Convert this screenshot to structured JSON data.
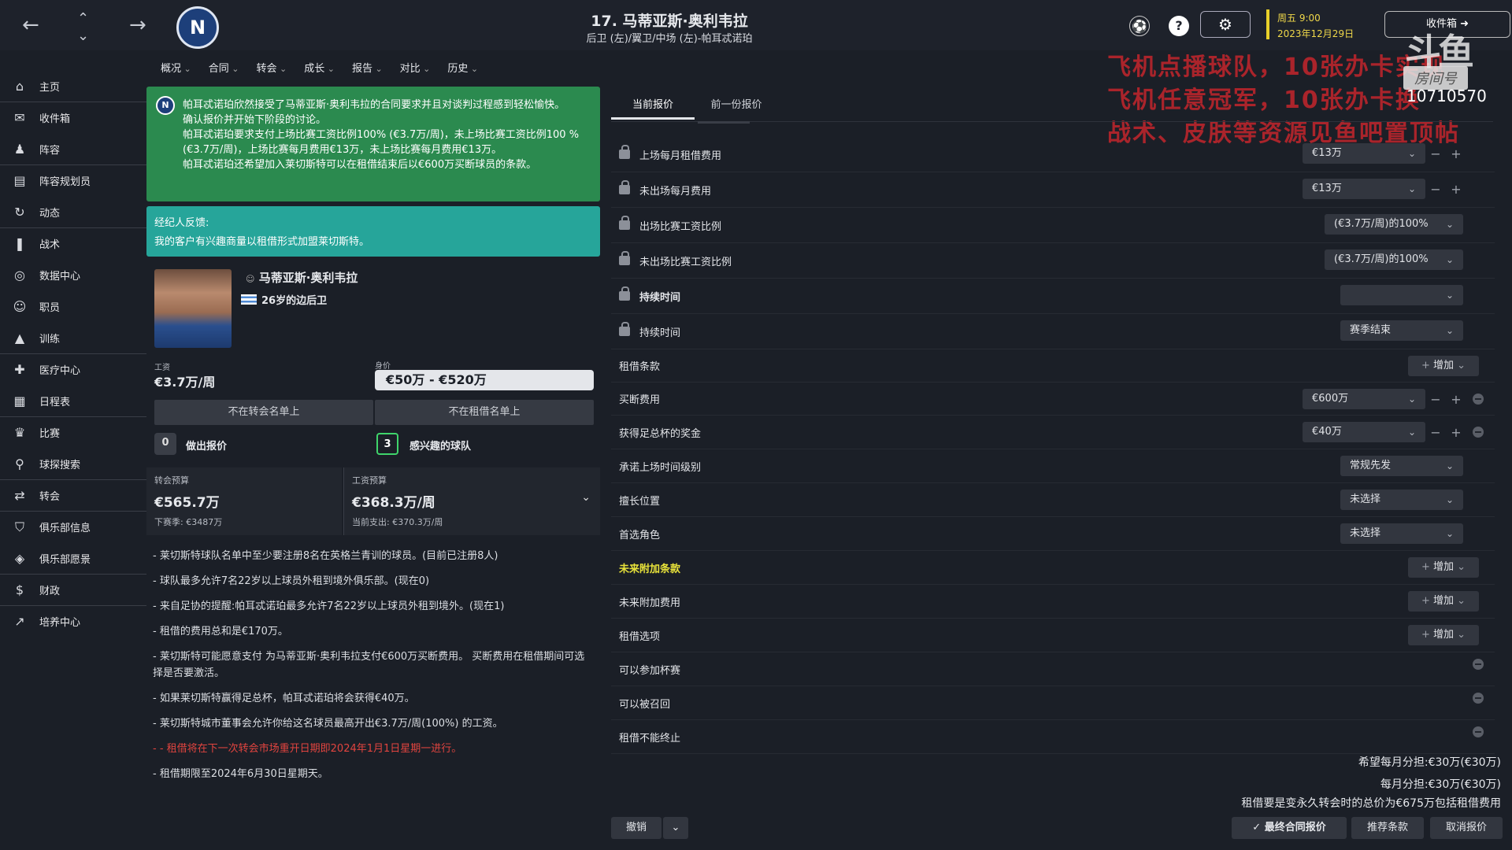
{
  "header": {
    "player_title": "17. 马蒂亚斯·奥利韦拉",
    "player_subtitle": "后卫 (左)/翼卫/中场 (左)-帕耳忒诺珀",
    "club_logo_letter": "N",
    "day_time": "周五 9:00",
    "date": "2023年12月29日",
    "inbox_label": "收件箱"
  },
  "overlay": {
    "line1": "飞机点播球队，10张办卡实现",
    "line2": "飞机任意冠军，10张办卡换",
    "line3": "战术、皮肤等资源见鱼吧置顶帖",
    "watermark": "斗鱼",
    "room_label": "房间号",
    "room_number": "10710570"
  },
  "sidebar": {
    "items": [
      {
        "label": "主页",
        "icon": "home-icon",
        "glyph": "⌂"
      },
      {
        "label": "收件箱",
        "icon": "inbox-icon",
        "glyph": "✉"
      },
      {
        "label": "阵容",
        "icon": "squad-icon",
        "glyph": "♟"
      },
      {
        "label": "阵容规划员",
        "icon": "clipboard-icon",
        "glyph": "▤"
      },
      {
        "label": "动态",
        "icon": "dynamics-icon",
        "glyph": "↻"
      },
      {
        "label": "战术",
        "icon": "tactics-icon",
        "glyph": "❚"
      },
      {
        "label": "数据中心",
        "icon": "data-hub-icon",
        "glyph": "◎"
      },
      {
        "label": "职员",
        "icon": "staff-icon",
        "glyph": "☺"
      },
      {
        "label": "训练",
        "icon": "training-icon",
        "glyph": "▲"
      },
      {
        "label": "医疗中心",
        "icon": "medical-icon",
        "glyph": "✚"
      },
      {
        "label": "日程表",
        "icon": "calendar-icon",
        "glyph": "▦"
      },
      {
        "label": "比赛",
        "icon": "trophy-icon",
        "glyph": "♛"
      },
      {
        "label": "球探搜索",
        "icon": "search-icon",
        "glyph": "⚲"
      },
      {
        "label": "转会",
        "icon": "transfer-icon",
        "glyph": "⇄"
      },
      {
        "label": "俱乐部信息",
        "icon": "shield-icon",
        "glyph": "⛉"
      },
      {
        "label": "俱乐部愿景",
        "icon": "vision-icon",
        "glyph": "◈"
      },
      {
        "label": "财政",
        "icon": "finance-icon",
        "glyph": "$"
      },
      {
        "label": "培养中心",
        "icon": "development-icon",
        "glyph": "↗"
      }
    ]
  },
  "menu": [
    "概况",
    "合同",
    "转会",
    "成长",
    "报告",
    "对比",
    "历史"
  ],
  "notice": {
    "lines": [
      "帕耳忒诺珀欣然接受了马蒂亚斯·奥利韦拉的合同要求并且对谈判过程感到轻松愉快。",
      "确认报价并开始下阶段的讨论。",
      "帕耳忒诺珀要求支付上场比赛工资比例100% (€3.7万/周)，未上场比赛工资比例100 % (€3.7万/周)，上场比赛每月费用€13万，未上场比赛每月费用€13万。",
      "帕耳忒诺珀还希望加入莱切斯特可以在租借结束后以€600万买断球员的条款。"
    ]
  },
  "agent": {
    "title": "经纪人反馈:",
    "text": "我的客户有兴趣商量以租借形式加盟莱切斯特。"
  },
  "player": {
    "name": "马蒂亚斯·奥利韦拉",
    "age_pos": "26岁的边后卫",
    "wage_label": "工资",
    "wage": "€3.7万/周",
    "value_label": "身价",
    "value": "€50万 - €520万",
    "transfer_list": "不在转会名单上",
    "loan_list": "不在租借名单上",
    "offers_count": "0",
    "offers_label": "做出报价",
    "interested_count": "3",
    "interested_label": "感兴趣的球队"
  },
  "budget": {
    "transfer_label": "转会预算",
    "transfer_value": "€565.7万",
    "transfer_sub": "下赛季: €3487万",
    "wage_label": "工资预算",
    "wage_value": "€368.3万/周",
    "wage_sub": "当前支出: €370.3万/周"
  },
  "notes": [
    {
      "text": "- 莱切斯特球队名单中至少要注册8名在英格兰青训的球员。(目前已注册8人)",
      "red": false
    },
    {
      "text": "- 球队最多允许7名22岁以上球员外租到境外俱乐部。(现在0)",
      "red": false
    },
    {
      "text": "- 来自足协的提醒:帕耳忒诺珀最多允许7名22岁以上球员外租到境外。(现在1)",
      "red": false
    },
    {
      "text": "- 租借的费用总和是€170万。",
      "red": false
    },
    {
      "text": "- 莱切斯特可能愿意支付 为马蒂亚斯·奥利韦拉支付€600万买断费用。 买断费用在租借期间可选择是否要激活。",
      "red": false
    },
    {
      "text": "- 如果莱切斯特赢得足总杯，帕耳忒诺珀将会获得€40万。",
      "red": false
    },
    {
      "text": "- 莱切斯特城市董事会允许你给这名球员最高开出€3.7万/周(100%) 的工资。",
      "red": false
    },
    {
      "text": "- - 租借将在下一次转会市场重开日期即2024年1月1日星期一进行。",
      "red": true
    },
    {
      "text": "- 租借期限至2024年6月30日星期天。",
      "red": false
    }
  ],
  "tabs": [
    "当前报价",
    "前一份报价"
  ],
  "rows": [
    {
      "label": "上场每月租借费用",
      "value": "€13万",
      "locked": true
    },
    {
      "label": "未出场每月费用",
      "value": "€13万",
      "locked": true
    },
    {
      "label": "出场比赛工资比例",
      "value": "(€3.7万/周)的100%",
      "locked": true
    },
    {
      "label": "未出场比赛工资比例",
      "value": "(€3.7万/周)的100%",
      "locked": true
    },
    {
      "label": "持续时间",
      "value": "",
      "locked": true
    },
    {
      "label": "持续时间",
      "value": "赛季结束",
      "locked": true
    },
    {
      "label": "租借条款",
      "add": "增加"
    },
    {
      "label": "买断费用",
      "value": "€600万"
    },
    {
      "label": "获得足总杯的奖金",
      "value": "€40万"
    },
    {
      "label": "承诺上场时间级别",
      "value": "常规先发"
    },
    {
      "label": "擅长位置",
      "value": "未选择"
    },
    {
      "label": "首选角色",
      "value": "未选择"
    },
    {
      "label": "未来附加条款",
      "add": "增加"
    },
    {
      "label": "未来附加费用",
      "add": "增加"
    },
    {
      "label": "租借选项",
      "add": "增加"
    },
    {
      "label": "可以参加杯赛"
    },
    {
      "label": "可以被召回"
    },
    {
      "label": "租借不能终止"
    }
  ],
  "summary": {
    "line1": "希望每月分担:€30万(€30万)",
    "line2": "每月分担:€30万(€30万)",
    "line3": "租借要是变永久转会时的总价为€675万包括租借费用"
  },
  "buttons": {
    "undo": "撤销",
    "final_offer": "最终合同报价",
    "suggest": "推荐条款",
    "cancel": "取消报价"
  },
  "colors": {
    "notice_green": "#2b8a4f",
    "agent_teal": "#26a59a",
    "future_yellow": "#e8e23a",
    "note_red": "#e2443f",
    "date_yellow": "#f0d84a"
  }
}
